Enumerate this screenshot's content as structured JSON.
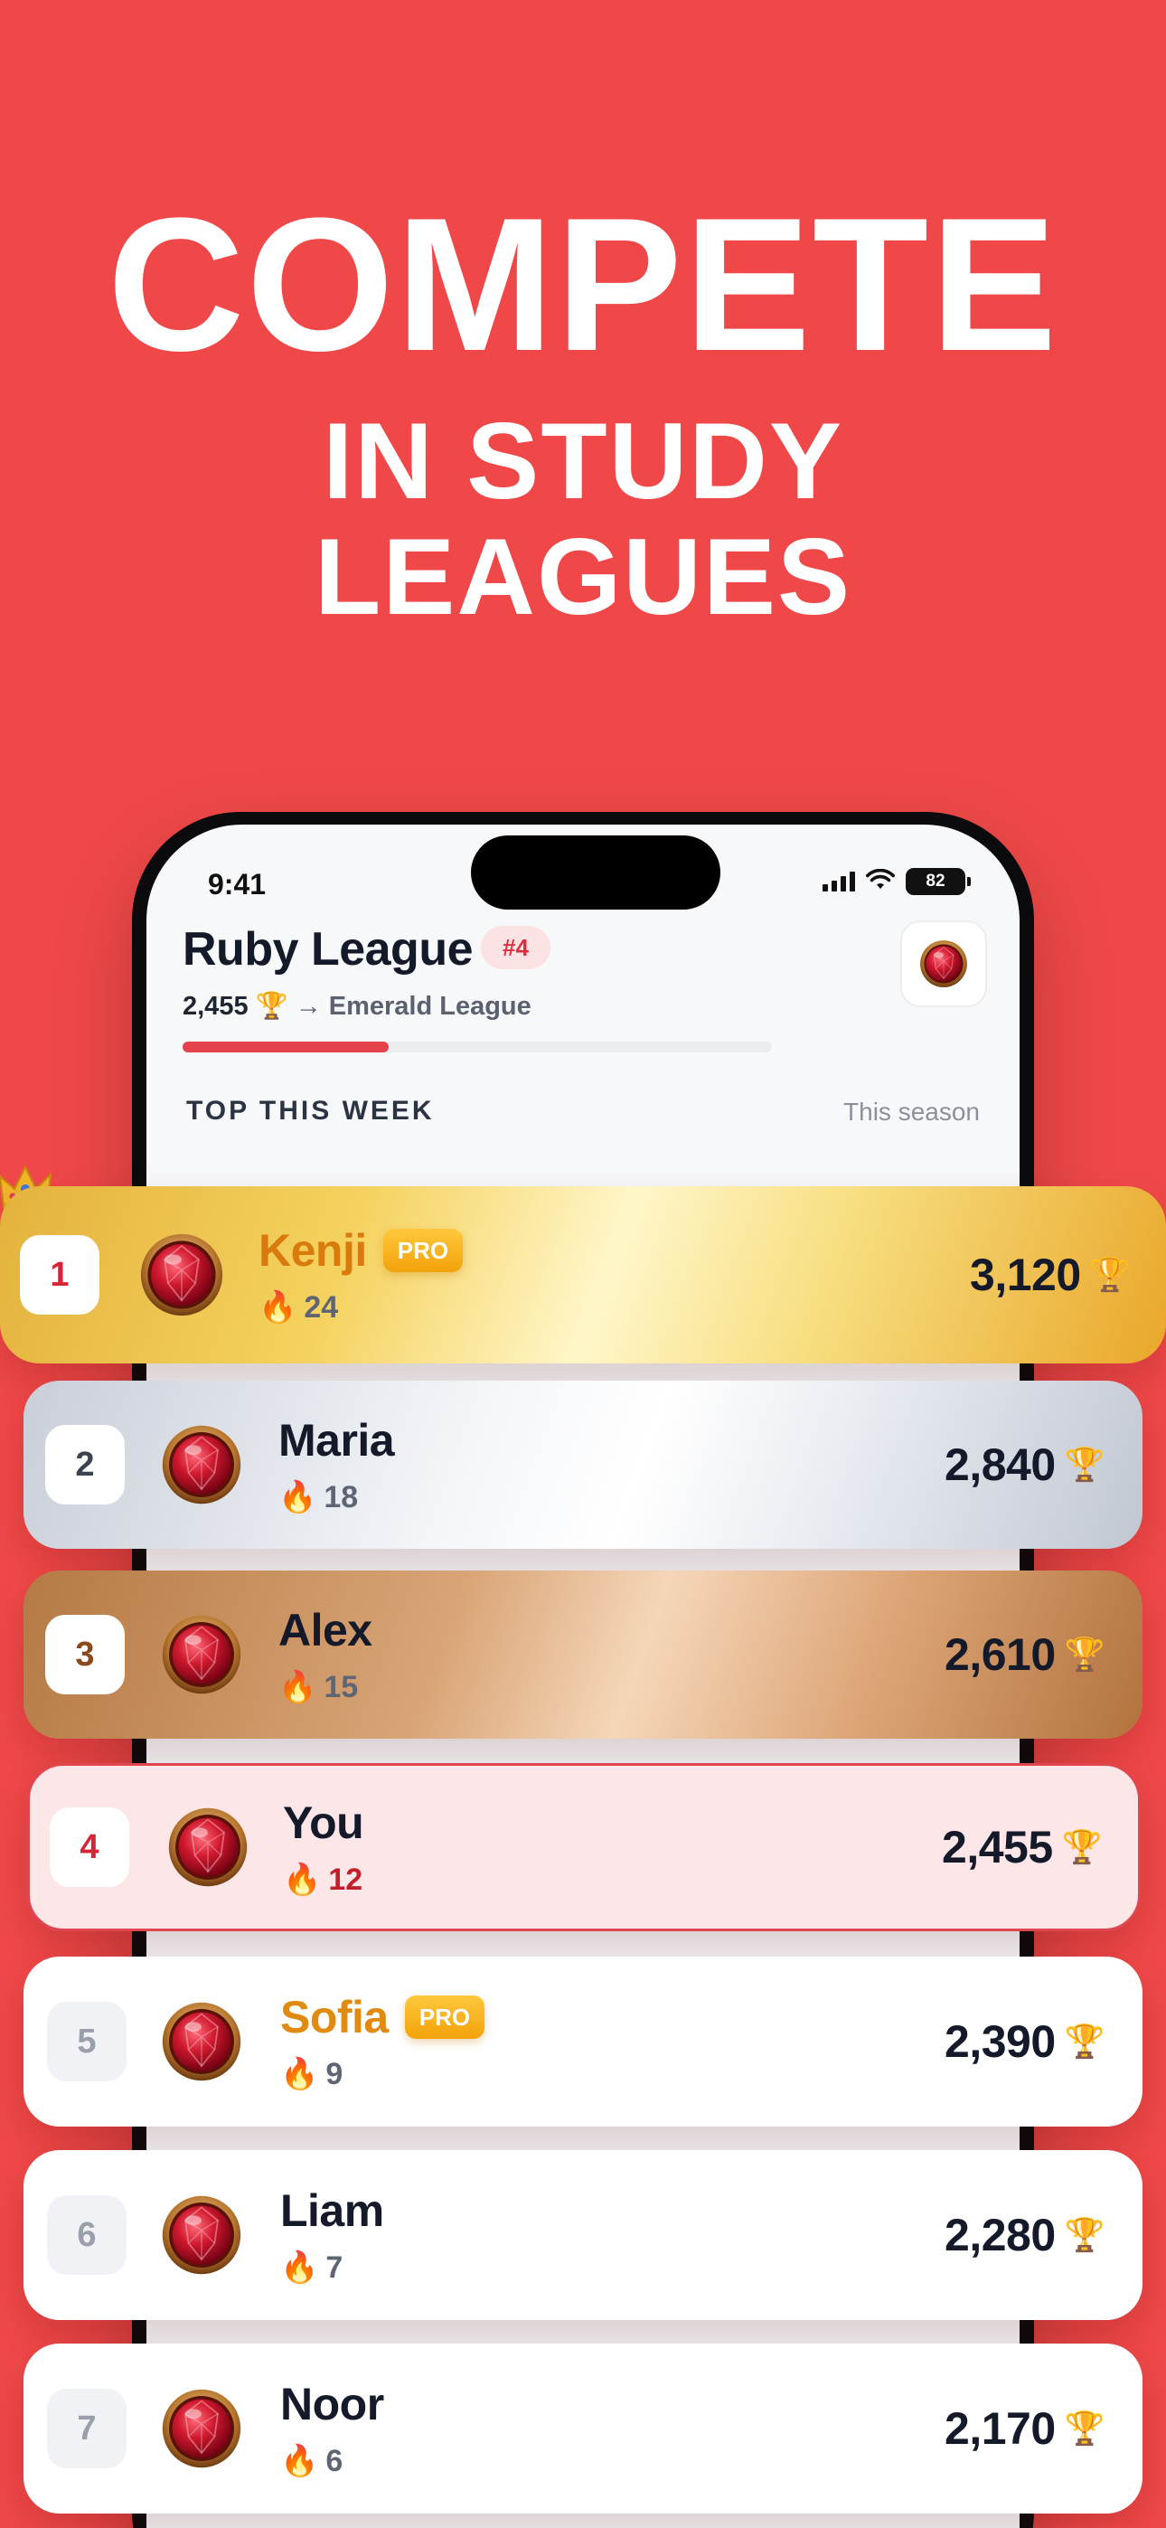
{
  "headline": {
    "line1": "COMPETE",
    "line2": "IN STUDY",
    "line3": "LEAGUES"
  },
  "status_bar": {
    "time": "9:41",
    "battery": "82"
  },
  "league": {
    "title": "Ruby League",
    "rank": "#4",
    "points": "2,455",
    "next_league": "→ Emerald League",
    "progress_fraction": 0.35
  },
  "section": {
    "title": "TOP THIS WEEK",
    "link": "This season"
  },
  "colors": {
    "background": "#F04848",
    "accent": "#E3424B",
    "pro_badge": "#F5B01F"
  },
  "pro_label": "PRO",
  "leaderboard": [
    {
      "rank": "1",
      "name": "Kenji",
      "pro": true,
      "streak": "24",
      "score": "3,120",
      "tier": "gold"
    },
    {
      "rank": "2",
      "name": "Maria",
      "pro": false,
      "streak": "18",
      "score": "2,840",
      "tier": "silver"
    },
    {
      "rank": "3",
      "name": "Alex",
      "pro": false,
      "streak": "15",
      "score": "2,610",
      "tier": "bronze"
    },
    {
      "rank": "4",
      "name": "You",
      "pro": false,
      "streak": "12",
      "score": "2,455",
      "tier": "self"
    },
    {
      "rank": "5",
      "name": "Sofia",
      "pro": true,
      "streak": "9",
      "score": "2,390",
      "tier": "plain"
    },
    {
      "rank": "6",
      "name": "Liam",
      "pro": false,
      "streak": "7",
      "score": "2,280",
      "tier": "plain"
    },
    {
      "rank": "7",
      "name": "Noor",
      "pro": false,
      "streak": "6",
      "score": "2,170",
      "tier": "plain"
    }
  ]
}
